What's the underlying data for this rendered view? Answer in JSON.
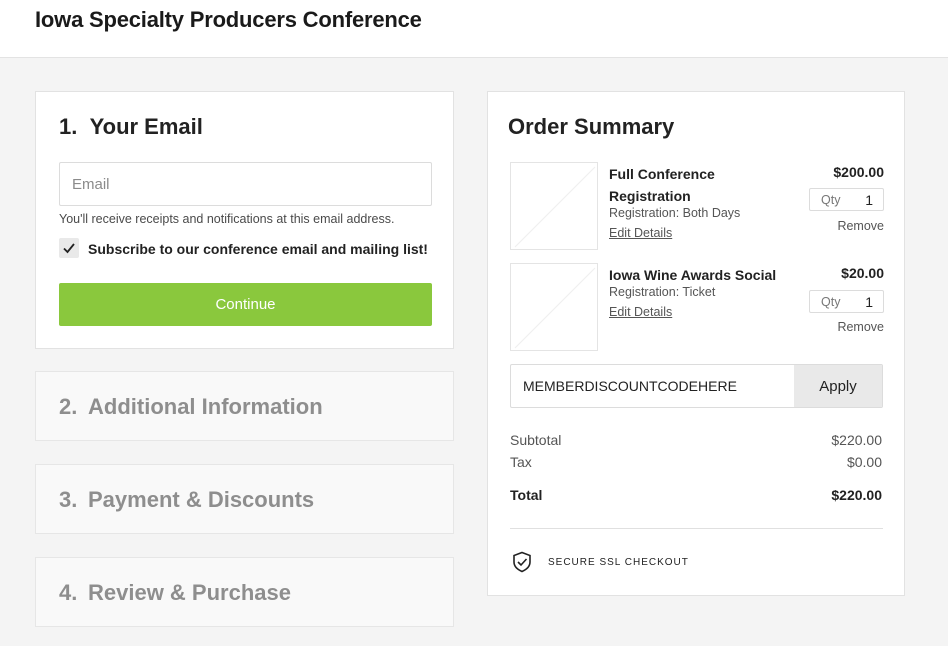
{
  "header": {
    "title": "Iowa Specialty Producers Conference"
  },
  "checkout": {
    "step1": {
      "number": "1.",
      "title": "Your Email",
      "email_placeholder": "Email",
      "email_value": "",
      "note": "You'll receive receipts and notifications at this email address.",
      "subscribe_label": "Subscribe to our conference email and mailing list!",
      "subscribe_checked": true,
      "continue_label": "Continue"
    },
    "steps": [
      {
        "number": "2.",
        "label": "Additional Information"
      },
      {
        "number": "3.",
        "label": "Payment & Discounts"
      },
      {
        "number": "4.",
        "label": "Review & Purchase"
      }
    ]
  },
  "summary": {
    "title": "Order Summary",
    "items": [
      {
        "name": "Full Conference Registration",
        "detail": "Registration: Both Days",
        "edit_label": "Edit Details",
        "price": "$200.00",
        "qty_label": "Qty",
        "qty": "1",
        "remove_label": "Remove",
        "image_icon": "placeholder-image-icon"
      },
      {
        "name": "Iowa Wine Awards Social",
        "detail": "Registration: Ticket",
        "edit_label": "Edit Details",
        "price": "$20.00",
        "qty_label": "Qty",
        "qty": "1",
        "remove_label": "Remove",
        "image_icon": "placeholder-image-icon"
      }
    ],
    "discount": {
      "value": "MEMBERDISCOUNTCODEHERE",
      "apply_label": "Apply"
    },
    "subtotal": {
      "label": "Subtotal",
      "value": "$220.00"
    },
    "tax": {
      "label": "Tax",
      "value": "$0.00"
    },
    "total": {
      "label": "Total",
      "value": "$220.00"
    },
    "secure": {
      "icon": "shield-check-icon",
      "label": "SECURE SSL CHECKOUT"
    }
  },
  "colors": {
    "accent": "#8ac83d",
    "page_bg": "#f4f4f4"
  }
}
